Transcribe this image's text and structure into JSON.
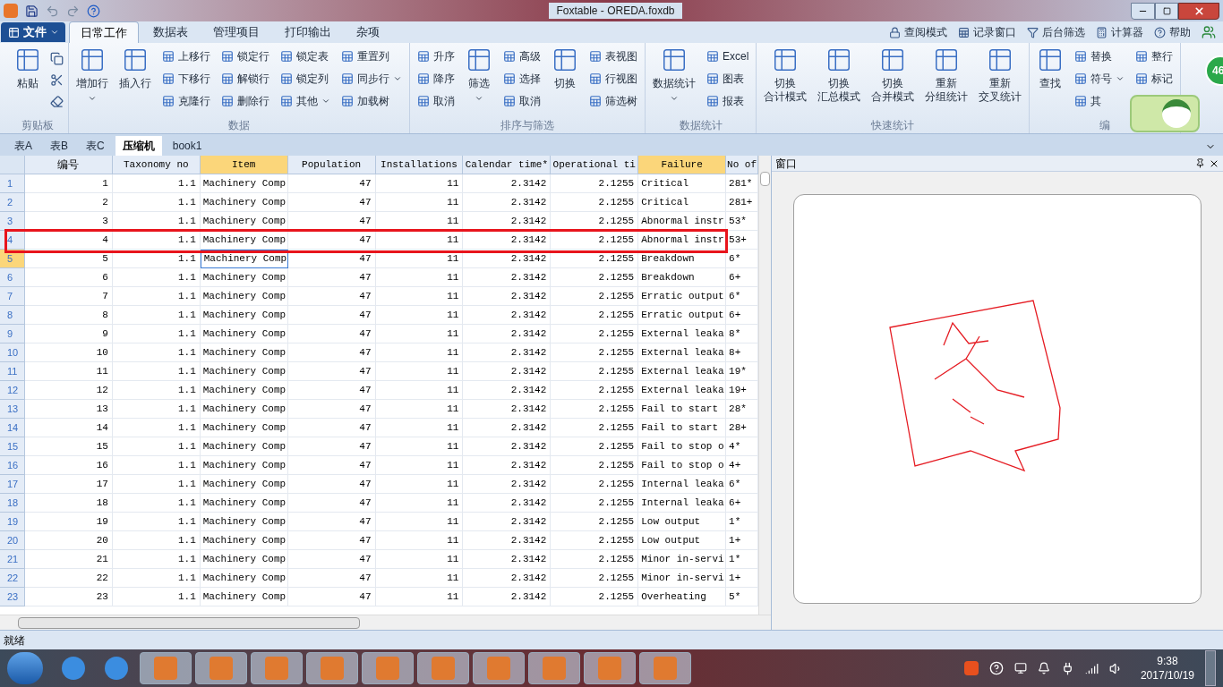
{
  "window": {
    "title": "Foxtable - OREDA.foxdb"
  },
  "menu": {
    "file_button": "文件",
    "tabs": [
      {
        "label": "日常工作",
        "selected": true
      },
      {
        "label": "数据表",
        "selected": false
      },
      {
        "label": "管理项目",
        "selected": false
      },
      {
        "label": "打印输出",
        "selected": false
      },
      {
        "label": "杂项",
        "selected": false
      }
    ],
    "right_items": [
      "查阅模式",
      "记录窗口",
      "后台筛选",
      "计算器",
      "帮助"
    ]
  },
  "ribbon": {
    "groups": [
      {
        "label": "剪贴板",
        "columns": [
          {
            "kind": "large",
            "lines": [
              "粘贴"
            ],
            "dropdown": false
          },
          {
            "kind": "icons"
          }
        ]
      },
      {
        "label": "数据",
        "columns": [
          {
            "kind": "large",
            "lines": [
              "增加行"
            ],
            "dropdown": true
          },
          {
            "kind": "large",
            "lines": [
              "插入行"
            ],
            "dropdown": false
          },
          {
            "kind": "small",
            "buttons": [
              {
                "label": "上移行",
                "dropdown": false
              },
              {
                "label": "下移行",
                "dropdown": false
              },
              {
                "label": "克隆行",
                "dropdown": false
              }
            ]
          },
          {
            "kind": "small",
            "buttons": [
              {
                "label": "锁定行",
                "dropdown": false
              },
              {
                "label": "解锁行",
                "dropdown": false
              },
              {
                "label": "删除行",
                "dropdown": false
              }
            ]
          },
          {
            "kind": "small",
            "buttons": [
              {
                "label": "锁定表",
                "dropdown": false
              },
              {
                "label": "锁定列",
                "dropdown": false
              },
              {
                "label": "其他",
                "dropdown": true
              }
            ]
          },
          {
            "kind": "small",
            "buttons": [
              {
                "label": "重置列",
                "dropdown": false
              },
              {
                "label": "同步行",
                "dropdown": true
              },
              {
                "label": "加载树",
                "dropdown": false
              }
            ]
          }
        ]
      },
      {
        "label": "排序与筛选",
        "columns": [
          {
            "kind": "small",
            "buttons": [
              {
                "label": "升序",
                "dropdown": false
              },
              {
                "label": "降序",
                "dropdown": false
              },
              {
                "label": "取消",
                "dropdown": false
              }
            ]
          },
          {
            "kind": "large",
            "lines": [
              "筛选"
            ],
            "dropdown": true
          },
          {
            "kind": "small",
            "buttons": [
              {
                "label": "高级",
                "dropdown": false
              },
              {
                "label": "选择",
                "dropdown": false
              },
              {
                "label": "取消",
                "dropdown": false
              }
            ]
          },
          {
            "kind": "large",
            "lines": [
              "切换"
            ],
            "dropdown": false
          },
          {
            "kind": "small",
            "buttons": [
              {
                "label": "表视图",
                "dropdown": false
              },
              {
                "label": "行视图",
                "dropdown": false
              },
              {
                "label": "筛选树",
                "dropdown": false
              }
            ]
          }
        ]
      },
      {
        "label": "数据统计",
        "columns": [
          {
            "kind": "large",
            "lines": [
              "数据统计"
            ],
            "dropdown": true
          },
          {
            "kind": "small",
            "buttons": [
              {
                "label": "Excel",
                "dropdown": false
              },
              {
                "label": "图表",
                "dropdown": false
              },
              {
                "label": "报表",
                "dropdown": false
              }
            ]
          }
        ]
      },
      {
        "label": "快速统计",
        "columns": [
          {
            "kind": "large",
            "lines": [
              "切换",
              "合计模式"
            ],
            "dropdown": false
          },
          {
            "kind": "large",
            "lines": [
              "切换",
              "汇总模式"
            ],
            "dropdown": false
          },
          {
            "kind": "large",
            "lines": [
              "切换",
              "合并模式"
            ],
            "dropdown": false
          },
          {
            "kind": "large",
            "lines": [
              "重新",
              "分组统计"
            ],
            "dropdown": false
          },
          {
            "kind": "large",
            "lines": [
              "重新",
              "交叉统计"
            ],
            "dropdown": false
          }
        ]
      },
      {
        "label": "编",
        "columns": [
          {
            "kind": "large",
            "lines": [
              "查找"
            ],
            "dropdown": false
          },
          {
            "kind": "small",
            "buttons": [
              {
                "label": "替换",
                "dropdown": false
              },
              {
                "label": "符号",
                "dropdown": true
              },
              {
                "label": "其",
                "dropdown": false
              }
            ]
          },
          {
            "kind": "small",
            "buttons": [
              {
                "label": "整行",
                "dropdown": false
              },
              {
                "label": "标记",
                "dropdown": false
              }
            ]
          }
        ]
      }
    ],
    "badge": "46"
  },
  "sheet_tabs": [
    {
      "label": "表A",
      "selected": false
    },
    {
      "label": "表B",
      "selected": false
    },
    {
      "label": "表C",
      "selected": false
    },
    {
      "label": "压缩机",
      "selected": true
    },
    {
      "label": "book1",
      "selected": false
    }
  ],
  "table": {
    "columns": [
      {
        "label": "编号",
        "kind": "number",
        "selected": false
      },
      {
        "label": "Taxonomy no",
        "kind": "number",
        "selected": false
      },
      {
        "label": "Item",
        "kind": "text",
        "selected": true
      },
      {
        "label": "Population",
        "kind": "number",
        "selected": false
      },
      {
        "label": "Installations",
        "kind": "number",
        "selected": false
      },
      {
        "label": "Calendar time*",
        "kind": "number",
        "selected": false
      },
      {
        "label": "Operational ti",
        "kind": "number",
        "selected": false
      },
      {
        "label": "Failure",
        "kind": "text",
        "selected": true
      },
      {
        "label": "No of",
        "kind": "text",
        "selected": false
      }
    ],
    "rows": [
      {
        "num": "1",
        "selected": false,
        "cells": [
          "1",
          "1.1",
          "Machinery Comp",
          "47",
          "11",
          "2.3142",
          "2.1255",
          "Critical",
          "281*"
        ]
      },
      {
        "num": "2",
        "selected": false,
        "cells": [
          "2",
          "1.1",
          "Machinery Comp",
          "47",
          "11",
          "2.3142",
          "2.1255",
          "Critical",
          "281+"
        ]
      },
      {
        "num": "3",
        "selected": false,
        "cells": [
          "3",
          "1.1",
          "Machinery Comp",
          "47",
          "11",
          "2.3142",
          "2.1255",
          "Abnormal instr",
          "53*"
        ]
      },
      {
        "num": "4",
        "selected": false,
        "cells": [
          "4",
          "1.1",
          "Machinery Comp",
          "47",
          "11",
          "2.3142",
          "2.1255",
          "Abnormal instr",
          "53+"
        ]
      },
      {
        "num": "5",
        "selected": true,
        "cells": [
          "5",
          "1.1",
          "Machinery Comp",
          "47",
          "11",
          "2.3142",
          "2.1255",
          "Breakdown",
          "6*"
        ]
      },
      {
        "num": "6",
        "selected": false,
        "cells": [
          "6",
          "1.1",
          "Machinery Comp",
          "47",
          "11",
          "2.3142",
          "2.1255",
          "Breakdown",
          "6+"
        ]
      },
      {
        "num": "7",
        "selected": false,
        "cells": [
          "7",
          "1.1",
          "Machinery Comp",
          "47",
          "11",
          "2.3142",
          "2.1255",
          "Erratic output",
          "6*"
        ]
      },
      {
        "num": "8",
        "selected": false,
        "cells": [
          "8",
          "1.1",
          "Machinery Comp",
          "47",
          "11",
          "2.3142",
          "2.1255",
          "Erratic output",
          "6+"
        ]
      },
      {
        "num": "9",
        "selected": false,
        "cells": [
          "9",
          "1.1",
          "Machinery Comp",
          "47",
          "11",
          "2.3142",
          "2.1255",
          "External leaka",
          "8*"
        ]
      },
      {
        "num": "10",
        "selected": false,
        "cells": [
          "10",
          "1.1",
          "Machinery Comp",
          "47",
          "11",
          "2.3142",
          "2.1255",
          "External leaka",
          "8+"
        ]
      },
      {
        "num": "11",
        "selected": false,
        "cells": [
          "11",
          "1.1",
          "Machinery Comp",
          "47",
          "11",
          "2.3142",
          "2.1255",
          "External leaka",
          "19*"
        ]
      },
      {
        "num": "12",
        "selected": false,
        "cells": [
          "12",
          "1.1",
          "Machinery Comp",
          "47",
          "11",
          "2.3142",
          "2.1255",
          "External leaka",
          "19+"
        ]
      },
      {
        "num": "13",
        "selected": false,
        "cells": [
          "13",
          "1.1",
          "Machinery Comp",
          "47",
          "11",
          "2.3142",
          "2.1255",
          "Fail to start",
          "28*"
        ]
      },
      {
        "num": "14",
        "selected": false,
        "cells": [
          "14",
          "1.1",
          "Machinery Comp",
          "47",
          "11",
          "2.3142",
          "2.1255",
          "Fail to start",
          "28+"
        ]
      },
      {
        "num": "15",
        "selected": false,
        "cells": [
          "15",
          "1.1",
          "Machinery Comp",
          "47",
          "11",
          "2.3142",
          "2.1255",
          "Fail to stop o",
          "4*"
        ]
      },
      {
        "num": "16",
        "selected": false,
        "cells": [
          "16",
          "1.1",
          "Machinery Comp",
          "47",
          "11",
          "2.3142",
          "2.1255",
          "Fail to stop o",
          "4+"
        ]
      },
      {
        "num": "17",
        "selected": false,
        "cells": [
          "17",
          "1.1",
          "Machinery Comp",
          "47",
          "11",
          "2.3142",
          "2.1255",
          "Internal leaka",
          "6*"
        ]
      },
      {
        "num": "18",
        "selected": false,
        "cells": [
          "18",
          "1.1",
          "Machinery Comp",
          "47",
          "11",
          "2.3142",
          "2.1255",
          "Internal leaka",
          "6+"
        ]
      },
      {
        "num": "19",
        "selected": false,
        "cells": [
          "19",
          "1.1",
          "Machinery Comp",
          "47",
          "11",
          "2.3142",
          "2.1255",
          "Low output",
          "1*"
        ]
      },
      {
        "num": "20",
        "selected": false,
        "cells": [
          "20",
          "1.1",
          "Machinery Comp",
          "47",
          "11",
          "2.3142",
          "2.1255",
          "Low output",
          "1+"
        ]
      },
      {
        "num": "21",
        "selected": false,
        "cells": [
          "21",
          "1.1",
          "Machinery Comp",
          "47",
          "11",
          "2.3142",
          "2.1255",
          "Minor in-servi",
          "1*"
        ]
      },
      {
        "num": "22",
        "selected": false,
        "cells": [
          "22",
          "1.1",
          "Machinery Comp",
          "47",
          "11",
          "2.3142",
          "2.1255",
          "Minor in-servi",
          "1+"
        ]
      },
      {
        "num": "23",
        "selected": false,
        "cells": [
          "23",
          "1.1",
          "Machinery Comp",
          "47",
          "11",
          "2.3142",
          "2.1255",
          "Overheating",
          "5*"
        ]
      }
    ]
  },
  "side_panel": {
    "title": "窗口"
  },
  "status_bar": {
    "text": "就绪"
  },
  "taskbar": {
    "time": "9:38",
    "date": "2017/10/19"
  }
}
